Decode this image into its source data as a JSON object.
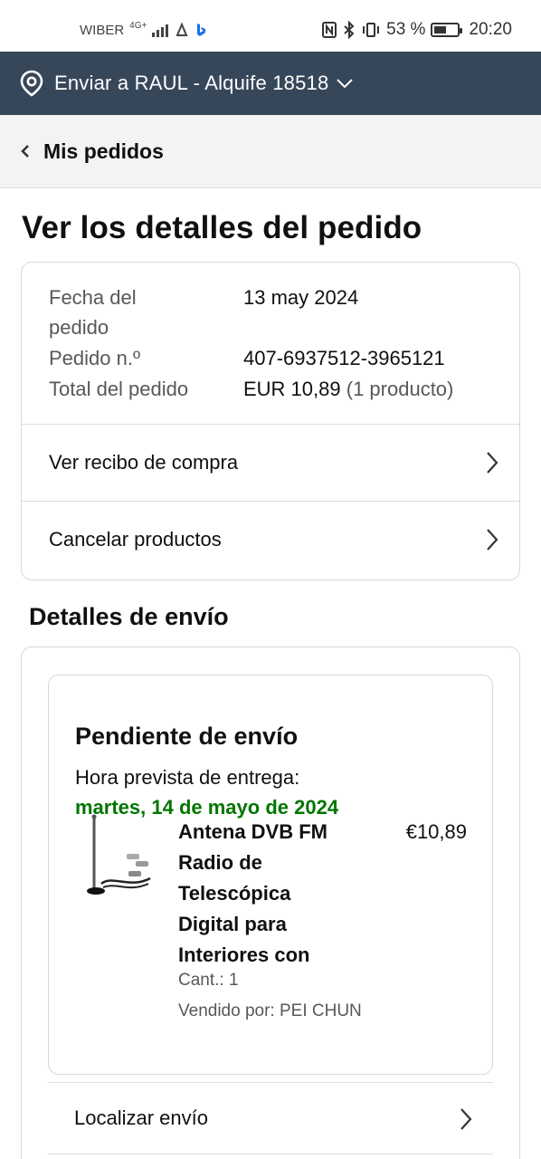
{
  "status_bar": {
    "carrier": "WIBER",
    "network": "4G+",
    "battery": "53 %",
    "battery_level": 0.53,
    "time": "20:20"
  },
  "location": {
    "text": "Enviar a RAUL - Alquife 18518",
    "icon": "location-pin-icon"
  },
  "nav": {
    "back_label": "Mis pedidos",
    "icon": "chevron-left-icon"
  },
  "page": {
    "title": "Ver los detalles del pedido"
  },
  "order": {
    "date_label_1": "Fecha del",
    "date_label_2": "pedido",
    "date_value": "13 may 2024",
    "number_label": "Pedido n.º",
    "number_value": "407-6937512-3965121",
    "total_label": "Total del pedido",
    "total_value": "EUR 10,89",
    "total_count": "(1 producto)",
    "links": {
      "receipt": "Ver recibo de compra",
      "cancel": "Cancelar productos"
    }
  },
  "shipping": {
    "section_title": "Detalles de envío",
    "status": "Pendiente de envío",
    "eta_label": "Hora prevista de entrega:",
    "eta_date": "martes, 14 de mayo de 2024",
    "product": {
      "title_lines": [
        "Antena DVB FM",
        "Radio de",
        "Telescópica",
        "Digital para",
        "Interiores con"
      ],
      "price": "€10,89",
      "quantity": "Cant.: 1",
      "seller": "Vendido por: PEI CHUN"
    },
    "track_label": "Localizar envío"
  },
  "colors": {
    "location_bar": "#37475a",
    "eta_green": "#007600",
    "muted_text": "#565959",
    "border": "#d5d9d9"
  }
}
